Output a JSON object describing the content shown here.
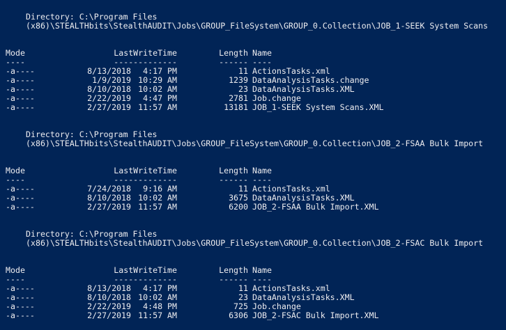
{
  "console": {
    "colors": {
      "background": "#012456",
      "foreground": "#eeedf0"
    }
  },
  "headers": {
    "mode": "Mode",
    "lastwritetime": "LastWriteTime",
    "length": "Length",
    "name": "Name",
    "mode_rule": "----",
    "lastwritetime_rule": "-------------",
    "length_rule": "------",
    "name_rule": "----"
  },
  "blocks": [
    {
      "directory_line": "Directory: C:\\Program Files",
      "directory_cont": "(x86)\\STEALTHbits\\StealthAUDIT\\Jobs\\GROUP_FileSystem\\GROUP_0.Collection\\JOB_1-SEEK System Scans",
      "rows": [
        {
          "mode": "-a----",
          "date": "8/13/2018",
          "time": "4:17 PM",
          "length": "11",
          "name": "ActionsTasks.xml"
        },
        {
          "mode": "-a----",
          "date": "1/9/2019",
          "time": "10:29 AM",
          "length": "1239",
          "name": "DataAnalysisTasks.change"
        },
        {
          "mode": "-a----",
          "date": "8/10/2018",
          "time": "10:02 AM",
          "length": "23",
          "name": "DataAnalysisTasks.XML"
        },
        {
          "mode": "-a----",
          "date": "2/22/2019",
          "time": "4:47 PM",
          "length": "2781",
          "name": "Job.change"
        },
        {
          "mode": "-a----",
          "date": "2/27/2019",
          "time": "11:57 AM",
          "length": "13181",
          "name": "JOB_1-SEEK System Scans.XML"
        }
      ]
    },
    {
      "directory_line": "Directory: C:\\Program Files",
      "directory_cont": "(x86)\\STEALTHbits\\StealthAUDIT\\Jobs\\GROUP_FileSystem\\GROUP_0.Collection\\JOB_2-FSAA Bulk Import",
      "rows": [
        {
          "mode": "-a----",
          "date": "7/24/2018",
          "time": "9:16 AM",
          "length": "11",
          "name": "ActionsTasks.xml"
        },
        {
          "mode": "-a----",
          "date": "8/10/2018",
          "time": "10:02 AM",
          "length": "3675",
          "name": "DataAnalysisTasks.XML"
        },
        {
          "mode": "-a----",
          "date": "2/27/2019",
          "time": "11:57 AM",
          "length": "6200",
          "name": "JOB_2-FSAA Bulk Import.XML"
        }
      ]
    },
    {
      "directory_line": "Directory: C:\\Program Files",
      "directory_cont": "(x86)\\STEALTHbits\\StealthAUDIT\\Jobs\\GROUP_FileSystem\\GROUP_0.Collection\\JOB_2-FSAC Bulk Import",
      "rows": [
        {
          "mode": "-a----",
          "date": "8/13/2018",
          "time": "4:17 PM",
          "length": "11",
          "name": "ActionsTasks.xml"
        },
        {
          "mode": "-a----",
          "date": "8/10/2018",
          "time": "10:02 AM",
          "length": "23",
          "name": "DataAnalysisTasks.XML"
        },
        {
          "mode": "-a----",
          "date": "2/22/2019",
          "time": "4:48 PM",
          "length": "725",
          "name": "Job.change"
        },
        {
          "mode": "-a----",
          "date": "2/27/2019",
          "time": "11:57 AM",
          "length": "6306",
          "name": "JOB_2-FSAC Bulk Import.XML"
        }
      ]
    }
  ]
}
